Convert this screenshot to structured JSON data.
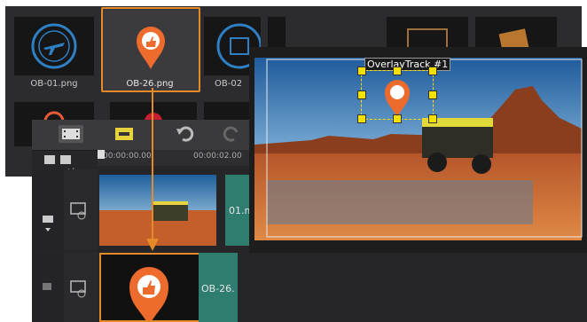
{
  "library": {
    "thumbnails": [
      {
        "label": "OB-01.png",
        "icon": "airplane-stamp-icon"
      },
      {
        "label": "OB-26.png",
        "icon": "map-pin-thumbs-up-icon"
      },
      {
        "label": "OB-02",
        "icon": "stamp-icon"
      },
      {
        "label": "",
        "icon": "compass-icon"
      },
      {
        "label": "",
        "icon": "departed-stamp-icon"
      },
      {
        "label": "",
        "icon": "frame-icon"
      }
    ]
  },
  "timeline": {
    "ruler": {
      "start": "00:00:00.00",
      "mid": "00:00:02.00"
    },
    "track_add_label": "+/-",
    "tracks": [
      {
        "clip_label": "01.m"
      },
      {
        "clip_label": "OB-26."
      }
    ]
  },
  "preview": {
    "overlay_label": "OverlayTrack #1"
  },
  "colors": {
    "accent": "#e48a2a",
    "handles": "#f3e000",
    "clip_teal": "#2e7d6f"
  }
}
